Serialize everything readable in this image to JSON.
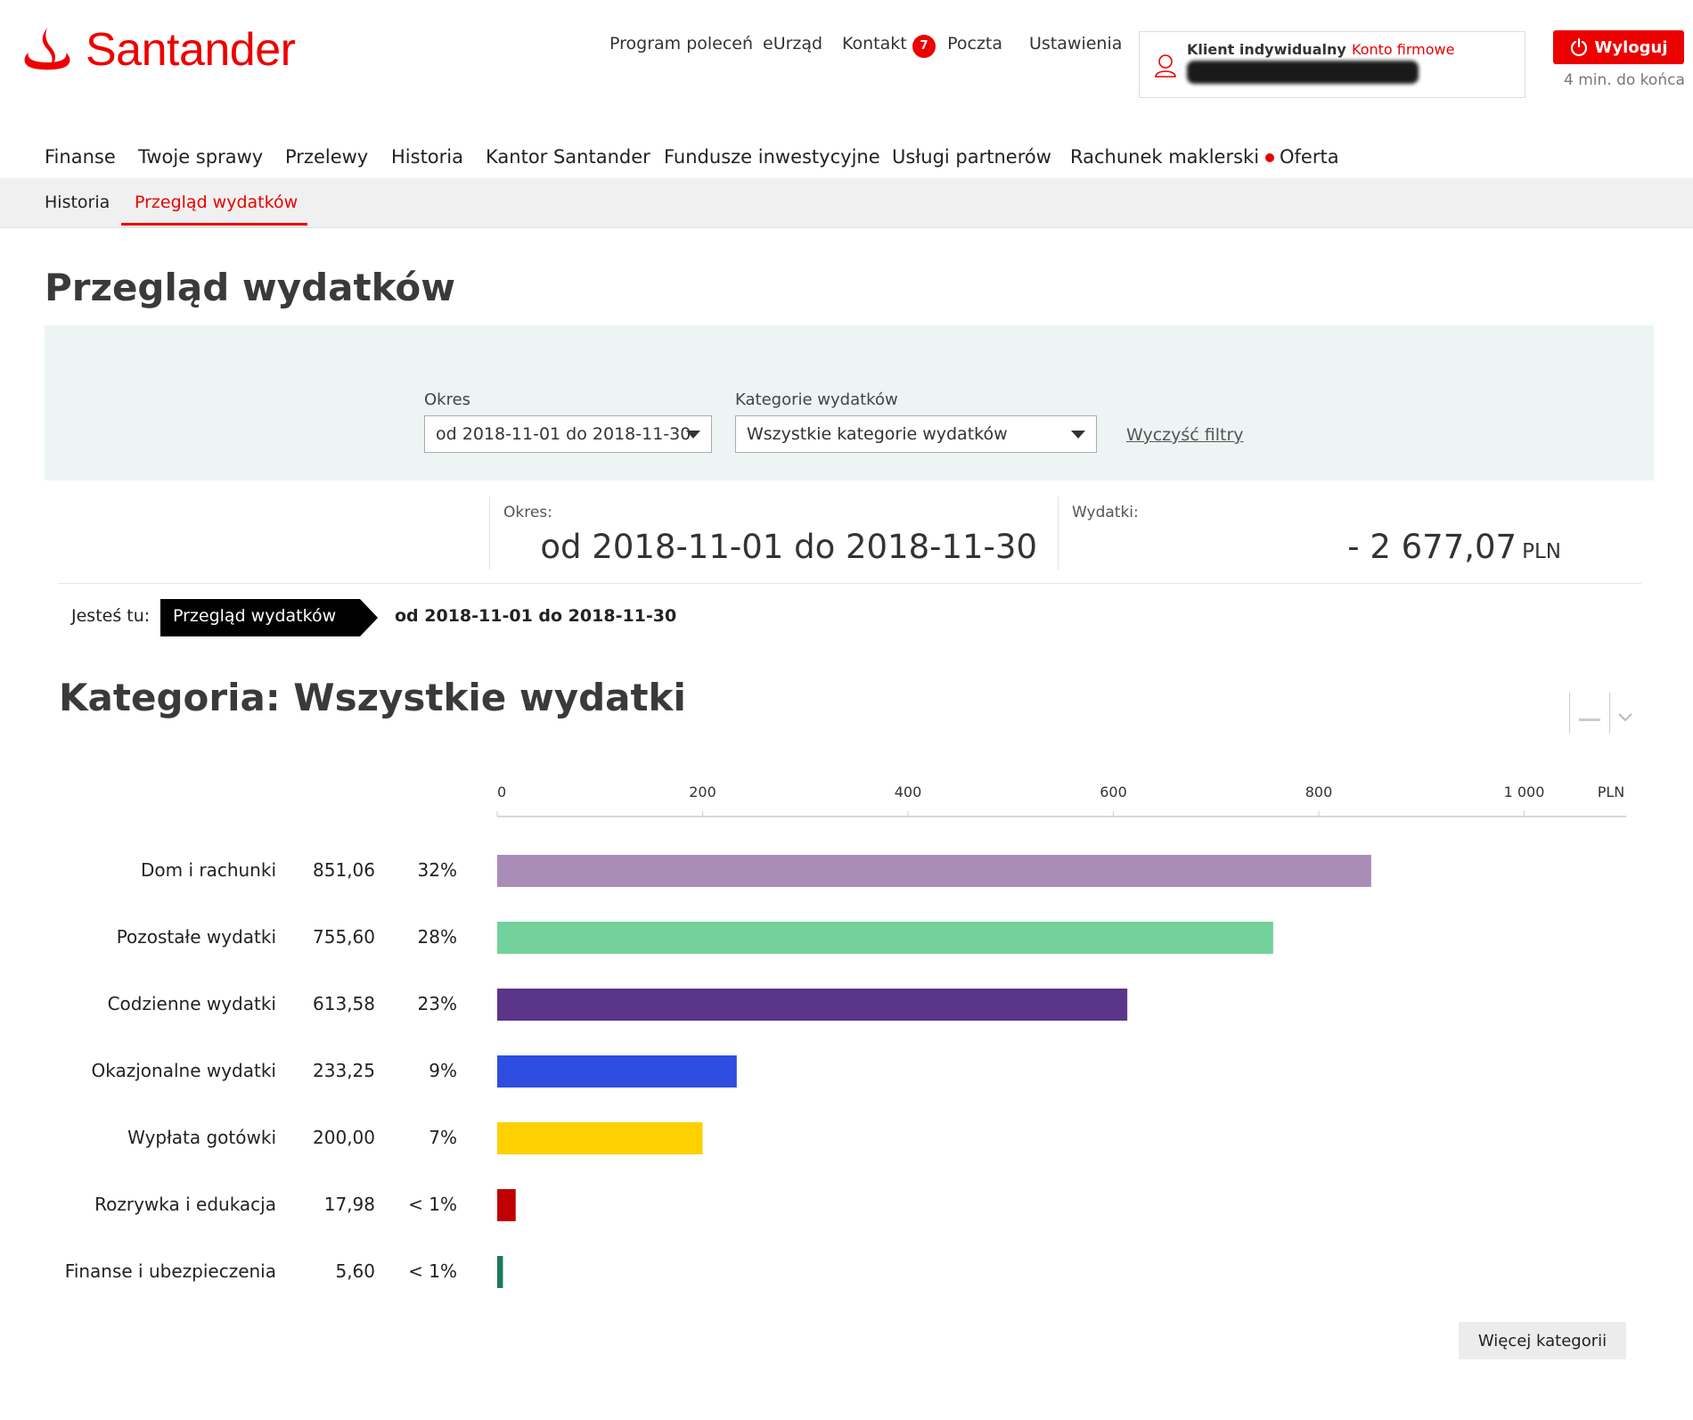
{
  "brand": {
    "name": "Santander",
    "color": "#ec0000"
  },
  "top_nav": {
    "referral": "Program poleceń",
    "eurzad": "eUrząd",
    "contact": "Kontakt",
    "mail_badge": "7",
    "mail": "Poczta",
    "settings": "Ustawienia"
  },
  "client": {
    "type_label": "Klient indywidualny",
    "company_link": "Konto firmowe"
  },
  "session": {
    "logout": "Wyloguj",
    "timer": "4 min. do końca"
  },
  "main_nav": [
    "Finanse",
    "Twoje sprawy",
    "Przelewy",
    "Historia",
    "Kantor Santander",
    "Fundusze inwestycyjne",
    "Usługi partnerów",
    "Rachunek maklerski",
    "Oferta"
  ],
  "sub_nav": {
    "history": "Historia",
    "expenses": "Przegląd wydatków"
  },
  "page_title": "Przegląd wydatków",
  "filters": {
    "period_label": "Okres",
    "period_value": "od 2018-11-01 do 2018-11-30",
    "category_label": "Kategorie wydatków",
    "category_value": "Wszystkie kategorie wydatków",
    "clear": "Wyczyść filtry"
  },
  "summary": {
    "period_label": "Okres:",
    "period_value": "od 2018-11-01 do 2018-11-30",
    "expenses_label": "Wydatki:",
    "expenses_value": "- 2 677,07",
    "currency": "PLN"
  },
  "breadcrumb": {
    "label": "Jesteś tu:",
    "chip": "Przegląd wydatków",
    "current": "od 2018-11-01 do 2018-11-30"
  },
  "category_title": "Kategoria: Wszystkie wydatki",
  "more_button": "Więcej kategorii",
  "chart_data": {
    "type": "bar",
    "orientation": "horizontal",
    "unit": "PLN",
    "xlim": [
      0,
      1100
    ],
    "ticks": [
      {
        "value": 0,
        "label": "0"
      },
      {
        "value": 200,
        "label": "200"
      },
      {
        "value": 400,
        "label": "400"
      },
      {
        "value": 600,
        "label": "600"
      },
      {
        "value": 800,
        "label": "800"
      },
      {
        "value": 1000,
        "label": "1 000"
      }
    ],
    "categories": [
      {
        "name": "Dom i rachunki",
        "value": 851.06,
        "value_label": "851,06",
        "pct": "32%",
        "color": "#a98cb8"
      },
      {
        "name": "Pozostałe wydatki",
        "value": 755.6,
        "value_label": "755,60",
        "pct": "28%",
        "color": "#73d19c"
      },
      {
        "name": "Codzienne wydatki",
        "value": 613.58,
        "value_label": "613,58",
        "pct": "23%",
        "color": "#5b3589"
      },
      {
        "name": "Okazjonalne wydatki",
        "value": 233.25,
        "value_label": "233,25",
        "pct": "9%",
        "color": "#2f4de0"
      },
      {
        "name": "Wypłata gotówki",
        "value": 200.0,
        "value_label": "200,00",
        "pct": "7%",
        "color": "#ffd000"
      },
      {
        "name": "Rozrywka i edukacja",
        "value": 17.98,
        "value_label": "17,98",
        "pct": "< 1%",
        "color": "#c00000"
      },
      {
        "name": "Finanse i ubezpieczenia",
        "value": 5.6,
        "value_label": "5,60",
        "pct": "< 1%",
        "color": "#1a7a5a"
      }
    ]
  }
}
